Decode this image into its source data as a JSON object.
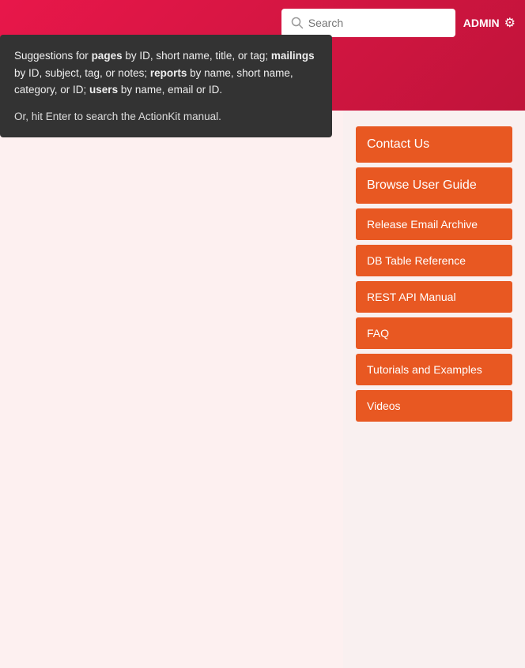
{
  "header": {
    "search_placeholder": "Search",
    "admin_label": "ADMIN"
  },
  "dropdown": {
    "line1_prefix": "Suggestions for ",
    "pages_keyword": "pages",
    "line1_middle1": " by ID, short name, title, or tag; ",
    "mailings_keyword": "mailings",
    "line1_middle2": " by ID, subject, tag, or notes; ",
    "reports_keyword": "reports",
    "line1_middle3": " by name, short name, category, or ID; ",
    "users_keyword": "users",
    "line1_suffix": " by name, email or ID.",
    "hint": "Or, hit Enter to search the ActionKit manual."
  },
  "sidebar": {
    "buttons": [
      {
        "id": "contact-us",
        "label": "Contact Us",
        "large": true
      },
      {
        "id": "browse-user-guide",
        "label": "Browse User Guide",
        "large": true
      },
      {
        "id": "release-email-archive",
        "label": "Release Email Archive",
        "large": false
      },
      {
        "id": "db-table-reference",
        "label": "DB Table Reference",
        "large": false
      },
      {
        "id": "rest-api-manual",
        "label": "REST API Manual",
        "large": false
      },
      {
        "id": "faq",
        "label": "FAQ",
        "large": false
      },
      {
        "id": "tutorials-and-examples",
        "label": "Tutorials and Examples",
        "large": false
      },
      {
        "id": "videos",
        "label": "Videos",
        "large": false
      }
    ]
  }
}
